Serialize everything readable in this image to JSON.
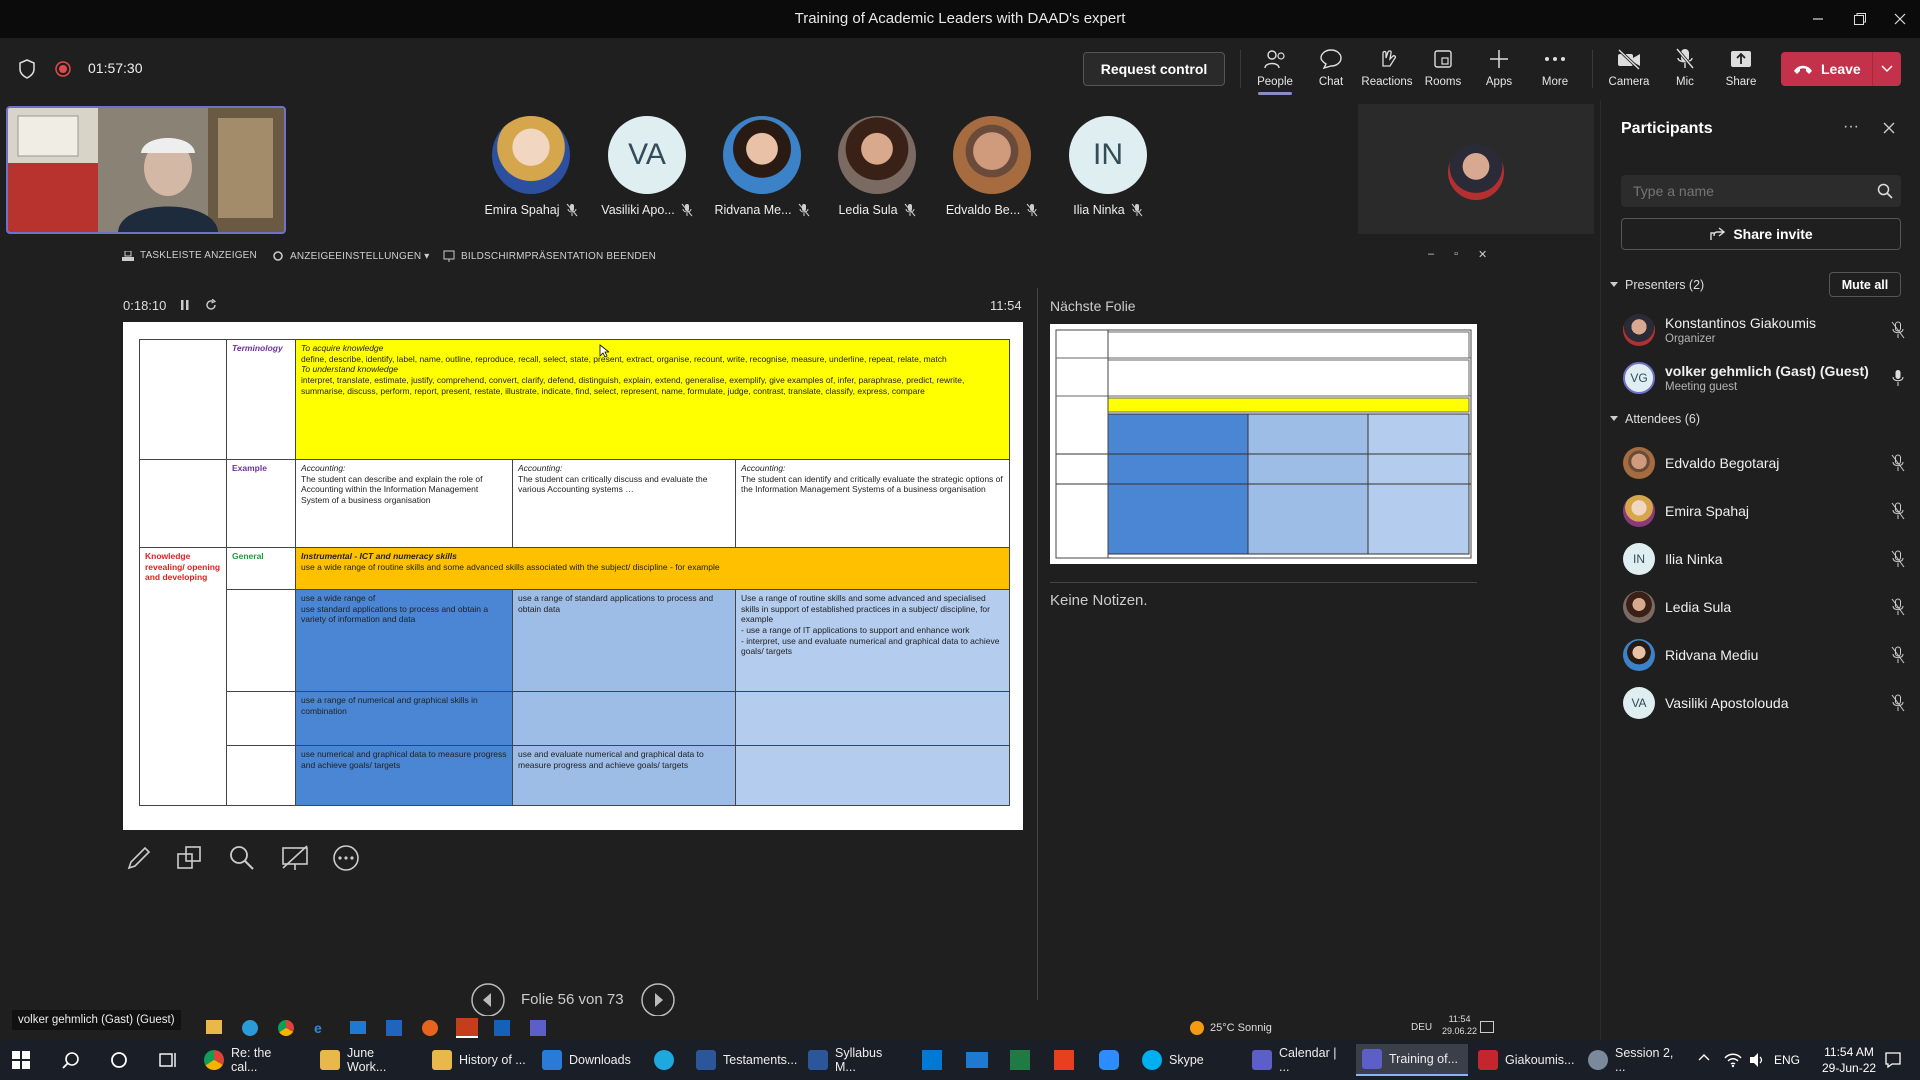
{
  "window": {
    "title": "Training of Academic Leaders with DAAD's expert"
  },
  "toolbar": {
    "timer": "01:57:30",
    "request_control": "Request control",
    "buttons": [
      "People",
      "Chat",
      "Reactions",
      "Rooms",
      "Apps",
      "More",
      "Camera",
      "Mic",
      "Share"
    ],
    "leave": "Leave"
  },
  "gallery": {
    "tiles": [
      {
        "name": "Emira Spahaj"
      },
      {
        "name": "Vasiliki Apo...",
        "initials": "VA"
      },
      {
        "name": "Ridvana Me..."
      },
      {
        "name": "Ledia Sula"
      },
      {
        "name": "Edvaldo Be..."
      },
      {
        "name": "Ilia Ninka",
        "initials": "IN"
      }
    ]
  },
  "presenter_view": {
    "top_bar": [
      "TASKLEISTE ANZEIGEN",
      "ANZEIGEEINSTELLUNGEN ▾",
      "BILDSCHIRMPRÄSENTATION BEENDEN"
    ],
    "elapsed": "0:18:10",
    "clock": "11:54",
    "next_slide_label": "Nächste Folie",
    "notes": "Keine Notizen.",
    "slide_counter": "Folie 56 von 73"
  },
  "slide": {
    "terminology_label": "Terminology",
    "acquire_title": "To acquire knowledge",
    "acquire_text": "define, describe, identify, label, name, outline, reproduce, recall, select, state, present, extract, organise, recount, write, recognise, measure, underline, repeat, relate, match",
    "understand_title": "To understand knowledge",
    "understand_text": "interpret, translate, estimate, justify, comprehend, convert, clarify, defend, distinguish, explain, extend, generalise, exemplify, give examples of, infer, paraphrase, predict, rewrite, summarise, discuss, perform, report, present, restate, illustrate, indicate, find, select, represent, name, formulate, judge, contrast, translate, classify, express, compare",
    "example_label": "Example",
    "acc_title": "Accounting:",
    "acc1": "The student can describe and explain the role of Accounting within the Information Management System of a business organisation",
    "acc2": "The student can critically discuss and evaluate the various Accounting systems …",
    "acc3": "The student can identify and critically evaluate the strategic options of the Information Management Systems of a business organisation",
    "knowledge_label": "Knowledge revealing/ opening and developing",
    "general_label": "General",
    "instr_title": "Instrumental - ICT and numeracy skills",
    "instr_text": "use a wide range of routine skills and some advanced skills associated with the subject/ discipline - for example",
    "r1c1": "use a wide range of\nuse standard applications to process and obtain a variety of information and data",
    "r1c2": "use a range of standard applications to process and obtain data",
    "r1c3": "Use a range of routine skills and some advanced and specialised skills in support of established practices in a subject/ discipline, for example\n- use a range of IT applications to support and enhance work\n- interpret, use and evaluate numerical and graphical data to achieve goals/ targets",
    "r2c1": "use a range of numerical and graphical skills in combination",
    "r3c1": "use numerical and graphical data to measure progress and achieve goals/ targets",
    "r3c2": "use and evaluate numerical and graphical data to measure progress and achieve goals/ targets"
  },
  "participants": {
    "title": "Participants",
    "search_placeholder": "Type a name",
    "share_invite": "Share invite",
    "presenters_label": "Presenters (2)",
    "mute_all": "Mute all",
    "presenters": [
      {
        "name": "Konstantinos Giakoumis",
        "role": "Organizer"
      },
      {
        "name": "volker gehmlich (Gast) (Guest)",
        "role": "Meeting guest",
        "initials": "VG"
      }
    ],
    "attendees_label": "Attendees (6)",
    "attendees": [
      {
        "name": "Edvaldo Begotaraj"
      },
      {
        "name": "Emira Spahaj"
      },
      {
        "name": "Ilia Ninka",
        "initials": "IN"
      },
      {
        "name": "Ledia Sula"
      },
      {
        "name": "Ridvana Mediu"
      },
      {
        "name": "Vasiliki Apostolouda",
        "initials": "VA"
      }
    ]
  },
  "inner_taskbar": {
    "tooltip": "volker gehmlich (Gast) (Guest)",
    "weather": "25°C Sonnig",
    "lang": "DEU",
    "time": "11:54",
    "date": "29.06.22"
  },
  "taskbar": {
    "apps": [
      "Re: the cal...",
      "June Work...",
      "History of ...",
      "Downloads",
      "Testaments...",
      "Syllabus M...",
      "Skype",
      "Calendar | ...",
      "Training of...",
      "Giakoumis...",
      "Session 2, ..."
    ],
    "lang": "ENG",
    "time": "11:54 AM",
    "date": "29-Jun-22"
  },
  "colors": {
    "leave": "#c4314b",
    "accent": "#6264a7",
    "yellow": "#ffff00",
    "orange": "#ffc000",
    "blue": "#4a86d4",
    "lightblue": "#9dbde6"
  }
}
